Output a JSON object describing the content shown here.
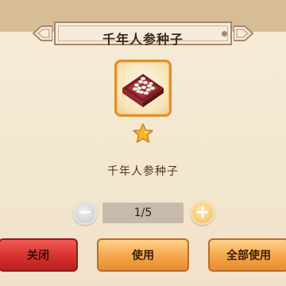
{
  "dialog": {
    "title": "千年人参种子",
    "item": {
      "icon": "ginseng-seed-box-icon",
      "rarity_stars": 1,
      "name": "千年人参种子"
    },
    "quantity": {
      "value": "1/5",
      "decrease_icon": "minus-icon",
      "increase_icon": "plus-icon"
    },
    "buttons": {
      "close": "关闭",
      "use": "使用",
      "use_all": "全部使用"
    }
  },
  "colors": {
    "panel": "#f6ebd6",
    "frame_accent": "#e28f2c",
    "close_button": "#d6312e",
    "action_button": "#f4a54a"
  }
}
